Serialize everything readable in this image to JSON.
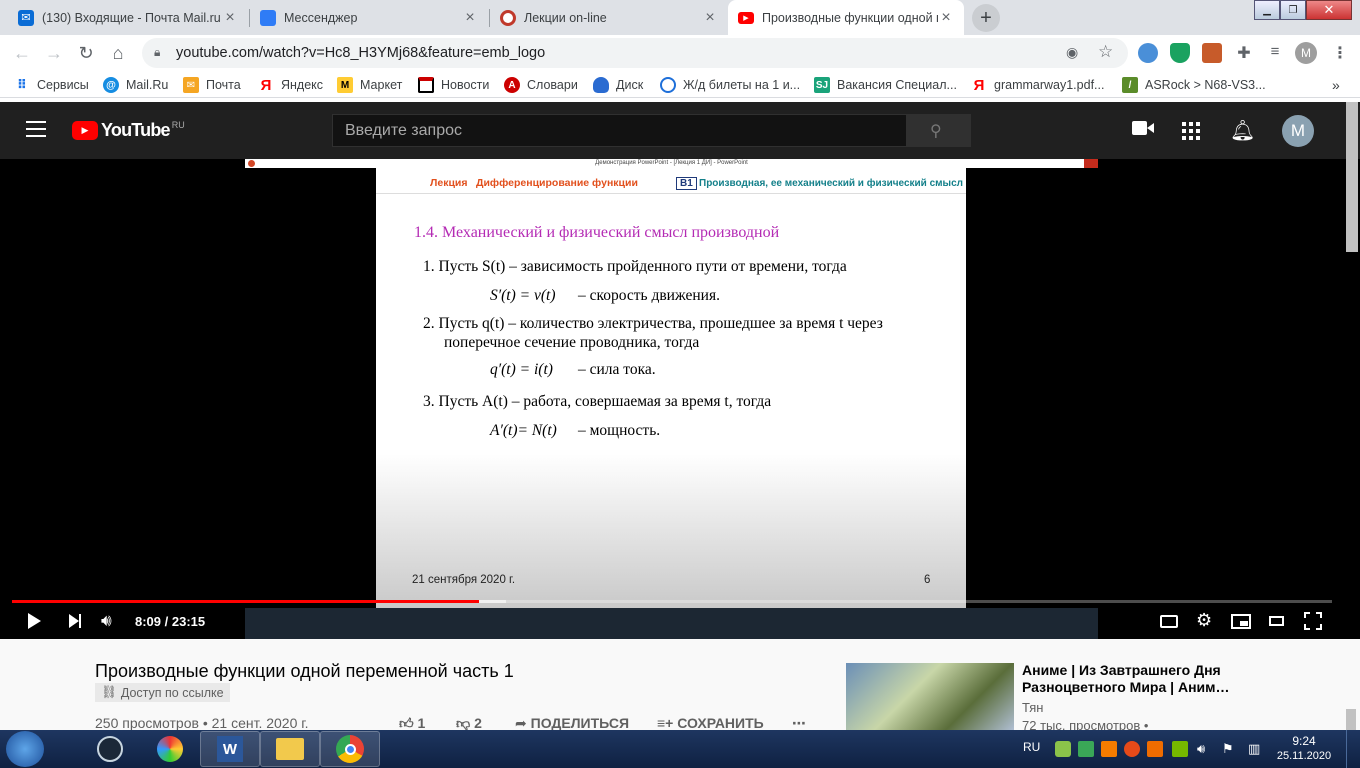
{
  "browser": {
    "tabs": [
      {
        "title": "(130) Входящие - Почта Mail.ru",
        "icon": "mail-icon",
        "color": "#0a6cd5"
      },
      {
        "title": "Мессенджер",
        "icon": "messenger-icon",
        "color": "#2f7cf6"
      },
      {
        "title": "Лекции on-line",
        "icon": "lectures-icon",
        "color": "#c0392b"
      },
      {
        "title": "Производные функции одной п",
        "icon": "youtube-icon",
        "color": "#ff0000",
        "active": true
      }
    ],
    "url": "youtube.com/watch?v=Hc8_H3YMj68&feature=emb_logo",
    "profile_initial": "M"
  },
  "bookmarks": [
    {
      "label": "Сервисы",
      "icon": "apps-grid-icon"
    },
    {
      "label": "Mail.Ru",
      "icon": "mailru-icon"
    },
    {
      "label": "Почта",
      "icon": "mail-envelope-icon"
    },
    {
      "label": "Яндекс",
      "icon": "yandex-icon"
    },
    {
      "label": "Маркет",
      "icon": "market-icon"
    },
    {
      "label": "Новости",
      "icon": "news-icon"
    },
    {
      "label": "Словари",
      "icon": "dictionary-icon"
    },
    {
      "label": "Диск",
      "icon": "disk-icon"
    },
    {
      "label": "Ж/д билеты на 1 и...",
      "icon": "train-icon"
    },
    {
      "label": "Вакансия Специал...",
      "icon": "sj-icon"
    },
    {
      "label": "grammarway1.pdf...",
      "icon": "yandex-icon"
    },
    {
      "label": "ASRock > N68-VS3...",
      "icon": "asrock-icon"
    }
  ],
  "youtube": {
    "logo": "YouTube",
    "region": "RU",
    "search_placeholder": "Введите запрос",
    "avatar_initial": "M"
  },
  "slide": {
    "window_title": "Демонстрация PowerPoint - [Лекция 1 ДИ] - PowerPoint",
    "header_left": "Лекция",
    "header_topic": "Дифференцирование функции",
    "header_badge": "В1",
    "header_right": "Производная, ее механический и физический смысл",
    "section_title": "1.4. Механический и физический смысл производной",
    "items": [
      {
        "line1": "1. Пусть S(t) – зависимость пройденного пути от времени, тогда",
        "formula": "S′(t) = v(t)",
        "meaning": "– скорость движения."
      },
      {
        "line1": "2. Пусть q(t) – количество электричества, прошедшее за время t через",
        "line2": "поперечное сечение проводника, тогда",
        "formula": "q′(t)  = i(t)",
        "meaning": "– сила тока."
      },
      {
        "line1": "3. Пусть A(t) – работа, совершаемая за время t, тогда",
        "formula": "A′(t)= N(t)",
        "meaning": "– мощность."
      }
    ],
    "footer_date": "21 сентября 2020 г.",
    "page_number": "6"
  },
  "player": {
    "current_time": "8:09",
    "duration": "23:15",
    "time_display": "8:09 / 23:15",
    "progress_fraction": 0.354
  },
  "video": {
    "title": "Производные функции одной переменной часть 1",
    "access_label": "Доступ по ссылке",
    "views_date": "250 просмотров • 21 сент. 2020 г.",
    "likes": "1",
    "dislikes": "2",
    "share_label": "ПОДЕЛИТЬСЯ",
    "save_label": "СОХРАНИТЬ"
  },
  "recommendation": {
    "title": "Аниме | Из Завтрашнего Дня Разноцветного Мира | Аним…",
    "channel": "Тян",
    "views": "72 тыс. просмотров •"
  },
  "taskbar": {
    "language": "RU",
    "time": "9:24",
    "date": "25.11.2020"
  }
}
